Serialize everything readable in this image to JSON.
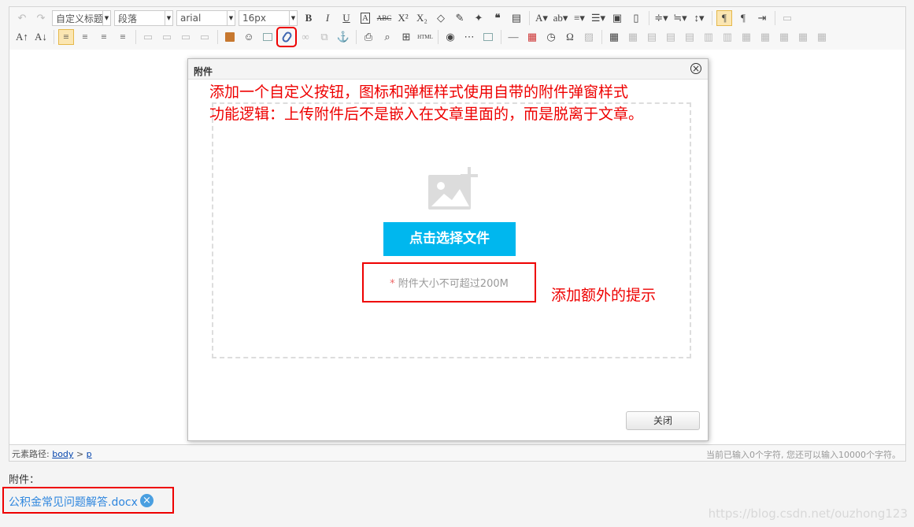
{
  "toolbar": {
    "paragraph_style": "自定义标题",
    "paragraph_format": "段落",
    "font_family": "arial",
    "font_size": "16px"
  },
  "dialog": {
    "title": "附件",
    "select_file_button": "点击选择文件",
    "size_tip_star": "*",
    "size_tip": "附件大小不可超过200M",
    "close_button": "关闭"
  },
  "annotations": {
    "line1": "添加一个自定义按钮，图标和弹框样式使用自带的附件弹窗样式",
    "line2": "功能逻辑：上传附件后不是嵌入在文章里面的，而是脱离于文章。",
    "tip_note": "添加额外的提示"
  },
  "statusbar": {
    "path_label": "元素路径:",
    "path_body": "body",
    "path_sep": ">",
    "path_p": "p",
    "char_count": "当前已输入0个字符, 您还可以输入10000个字符。"
  },
  "attachments": {
    "label": "附件：",
    "files": [
      "公积金常见问题解答.docx"
    ],
    "remove_icon": "×"
  },
  "watermark": "https://blog.csdn.net/ouzhong123",
  "colors": {
    "accent_blue": "#00b7ee",
    "highlight_red": "#e00000",
    "link_blue": "#2e86de"
  }
}
